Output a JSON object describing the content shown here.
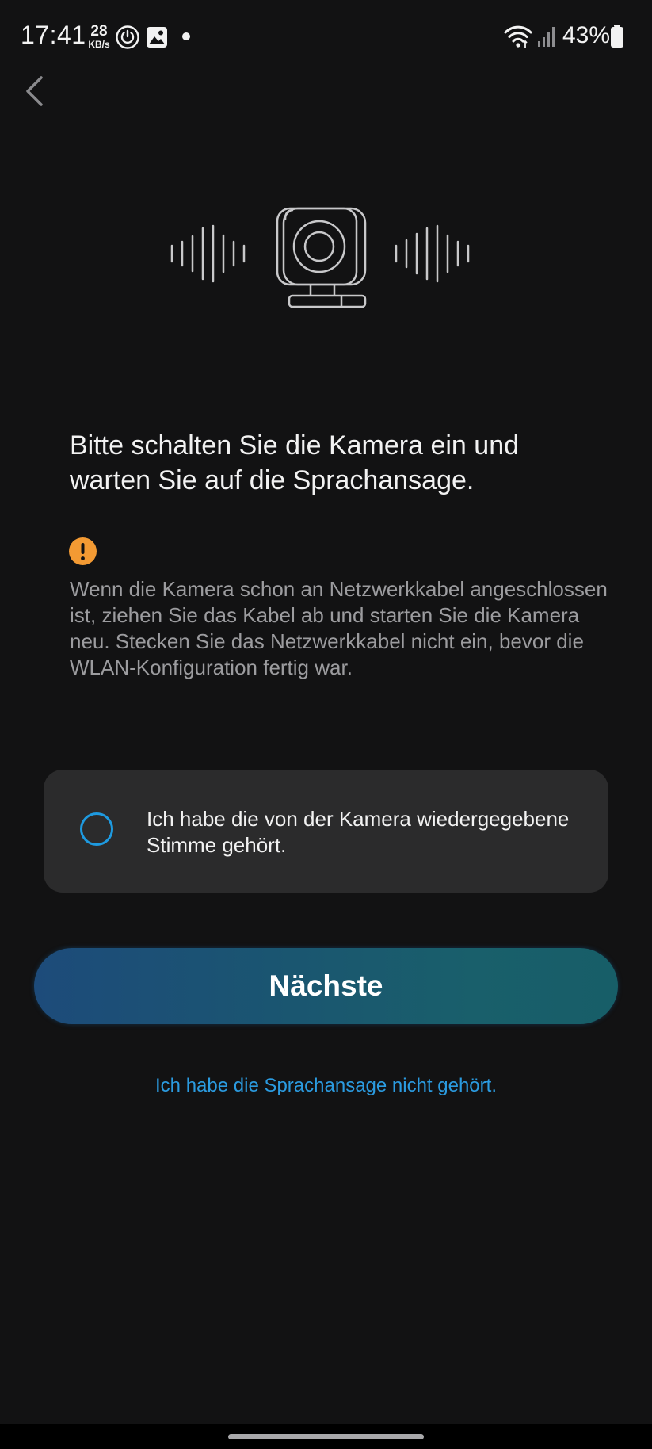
{
  "status_bar": {
    "time": "17:41",
    "net_speed_value": "28",
    "net_speed_unit": "KB/s",
    "battery_percent": "43%",
    "icons": [
      "data-saver-icon",
      "gallery-icon",
      "notification-dot-icon",
      "wifi-icon",
      "signal-icon",
      "battery-icon"
    ]
  },
  "header": {
    "back_icon": "chevron-left-icon"
  },
  "illustration": {
    "icon": "camera-sound-icon"
  },
  "main": {
    "title": "Bitte schalten Sie die Kamera ein und warten Sie auf die Sprachansage.",
    "warning_icon": "warning-icon",
    "notice": "Wenn die Kamera schon an Netzwerkkabel angeschlossen ist, ziehen Sie das Kabel ab und starten Sie die Kamera neu. Stecken Sie das Netzwerkkabel nicht ein, bevor die WLAN-Konfiguration fertig war."
  },
  "confirm": {
    "label": "Ich habe die von der Kamera wiedergegebene Stimme gehört.",
    "checked": false
  },
  "actions": {
    "next_label": "Nächste",
    "not_heard_link": "Ich habe die Sprachansage nicht gehört."
  },
  "colors": {
    "background": "#121213",
    "card": "#2b2b2c",
    "accent_blue": "#2b9be0",
    "warning_orange": "#f39a33",
    "button_gradient_start": "#1d4b7a",
    "button_gradient_end": "#175e68"
  }
}
